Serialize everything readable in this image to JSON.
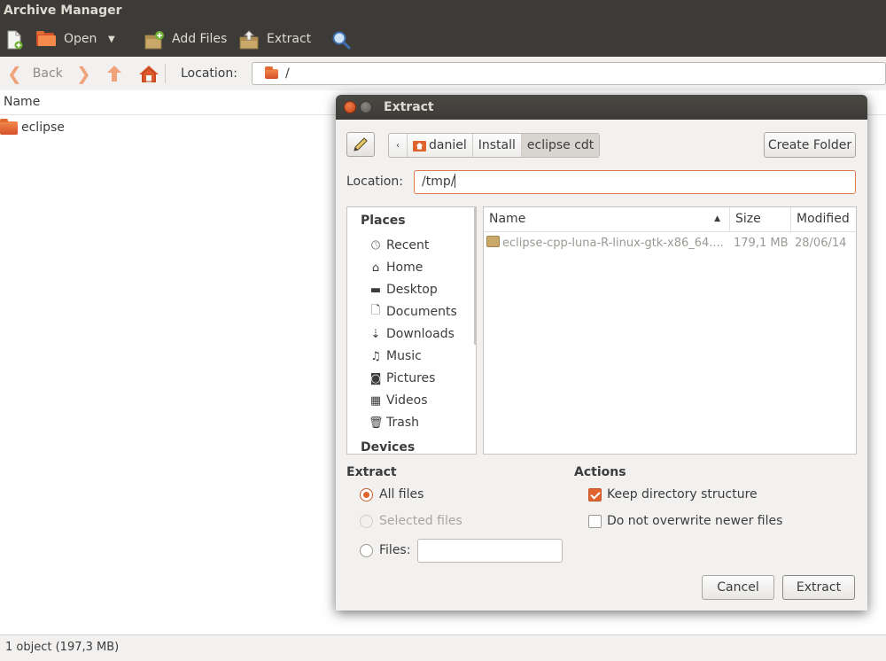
{
  "window": {
    "title": "Archive Manager"
  },
  "toolbar": {
    "open_label": "Open",
    "add_files_label": "Add Files",
    "extract_label": "Extract",
    "icons": [
      "new-archive-icon",
      "open-icon",
      "dropdown-arrow-icon",
      "add-files-icon",
      "extract-icon",
      "search-icon"
    ]
  },
  "navbar": {
    "back_label": "Back",
    "location_label": "Location:",
    "location_value": "/"
  },
  "archive_list": {
    "column_name": "Name",
    "items": [
      {
        "name": "eclipse"
      }
    ]
  },
  "status": {
    "text": "1 object (197,3 MB)"
  },
  "dialog": {
    "title": "Extract",
    "breadcrumbs": [
      "daniel",
      "Install",
      "eclipse cdt"
    ],
    "create_folder_label": "Create Folder",
    "location_label": "Location:",
    "location_value": "/tmp/",
    "places_header": "Places",
    "places": [
      "Recent",
      "Home",
      "Desktop",
      "Documents",
      "Downloads",
      "Music",
      "Pictures",
      "Videos",
      "Trash"
    ],
    "devices_header": "Devices",
    "file_columns": {
      "name": "Name",
      "size": "Size",
      "modified": "Modified"
    },
    "files": [
      {
        "name": "eclipse-cpp-luna-R-linux-gtk-x86_64....",
        "size": "179,1 MB",
        "modified": "28/06/14"
      }
    ],
    "extract_section": {
      "title": "Extract",
      "all_files": "All files",
      "selected_files": "Selected files",
      "files_label": "Files:",
      "files_value": ""
    },
    "actions_section": {
      "title": "Actions",
      "keep_structure": "Keep directory structure",
      "keep_structure_checked": true,
      "no_overwrite": "Do not overwrite newer files",
      "no_overwrite_checked": false
    },
    "cancel_label": "Cancel",
    "extract_label": "Extract"
  },
  "colors": {
    "accent": "#e0622d",
    "titlebar": "#3c3b37",
    "dialog_bg": "#f2f1f0"
  }
}
